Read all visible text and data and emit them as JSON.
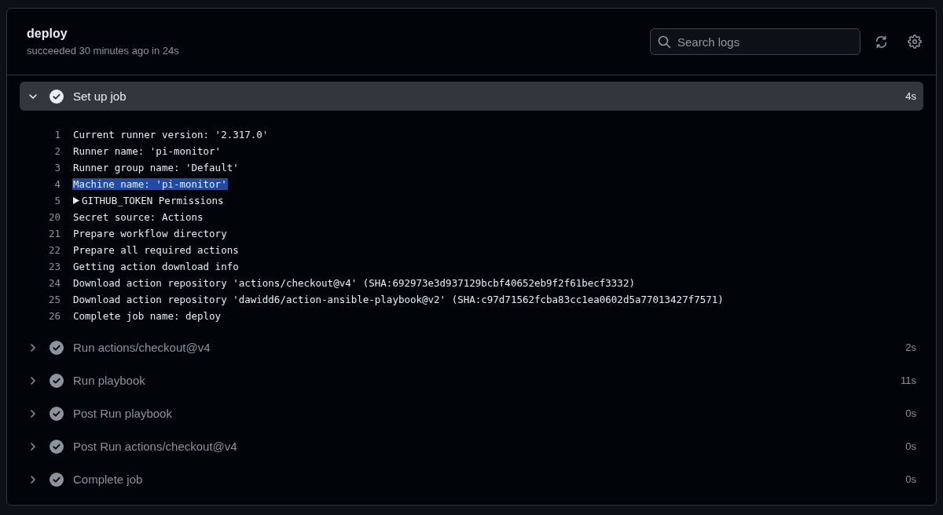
{
  "job": {
    "title": "deploy",
    "status": "succeeded 30 minutes ago in 24s"
  },
  "search": {
    "placeholder": "Search logs"
  },
  "steps": [
    {
      "name": "Set up job",
      "duration": "4s",
      "expanded": true,
      "log": [
        {
          "number": "1",
          "text": "Current runner version: '2.317.0'",
          "kind": "line",
          "highlighted": false
        },
        {
          "number": "2",
          "text": "Runner name: 'pi-monitor'",
          "kind": "line",
          "highlighted": false
        },
        {
          "number": "3",
          "text": "Runner group name: 'Default'",
          "kind": "line",
          "highlighted": false
        },
        {
          "number": "4",
          "text": "Machine name: 'pi-monitor'",
          "kind": "line",
          "highlighted": true
        },
        {
          "number": "5",
          "text": "GITHUB_TOKEN Permissions",
          "kind": "group",
          "highlighted": false
        },
        {
          "number": "20",
          "text": "Secret source: Actions",
          "kind": "line",
          "highlighted": false
        },
        {
          "number": "21",
          "text": "Prepare workflow directory",
          "kind": "line",
          "highlighted": false
        },
        {
          "number": "22",
          "text": "Prepare all required actions",
          "kind": "line",
          "highlighted": false
        },
        {
          "number": "23",
          "text": "Getting action download info",
          "kind": "line",
          "highlighted": false
        },
        {
          "number": "24",
          "text": "Download action repository 'actions/checkout@v4' (SHA:692973e3d937129bcbf40652eb9f2f61becf3332)",
          "kind": "line",
          "highlighted": false
        },
        {
          "number": "25",
          "text": "Download action repository 'dawidd6/action-ansible-playbook@v2' (SHA:c97d71562fcba83cc1ea0602d5a77013427f7571)",
          "kind": "line",
          "highlighted": false
        },
        {
          "number": "26",
          "text": "Complete job name: deploy",
          "kind": "line",
          "highlighted": false
        }
      ]
    },
    {
      "name": "Run actions/checkout@v4",
      "duration": "2s",
      "expanded": false
    },
    {
      "name": "Run playbook",
      "duration": "11s",
      "expanded": false
    },
    {
      "name": "Post Run playbook",
      "duration": "0s",
      "expanded": false
    },
    {
      "name": "Post Run actions/checkout@v4",
      "duration": "0s",
      "expanded": false
    },
    {
      "name": "Complete job",
      "duration": "0s",
      "expanded": false
    }
  ]
}
